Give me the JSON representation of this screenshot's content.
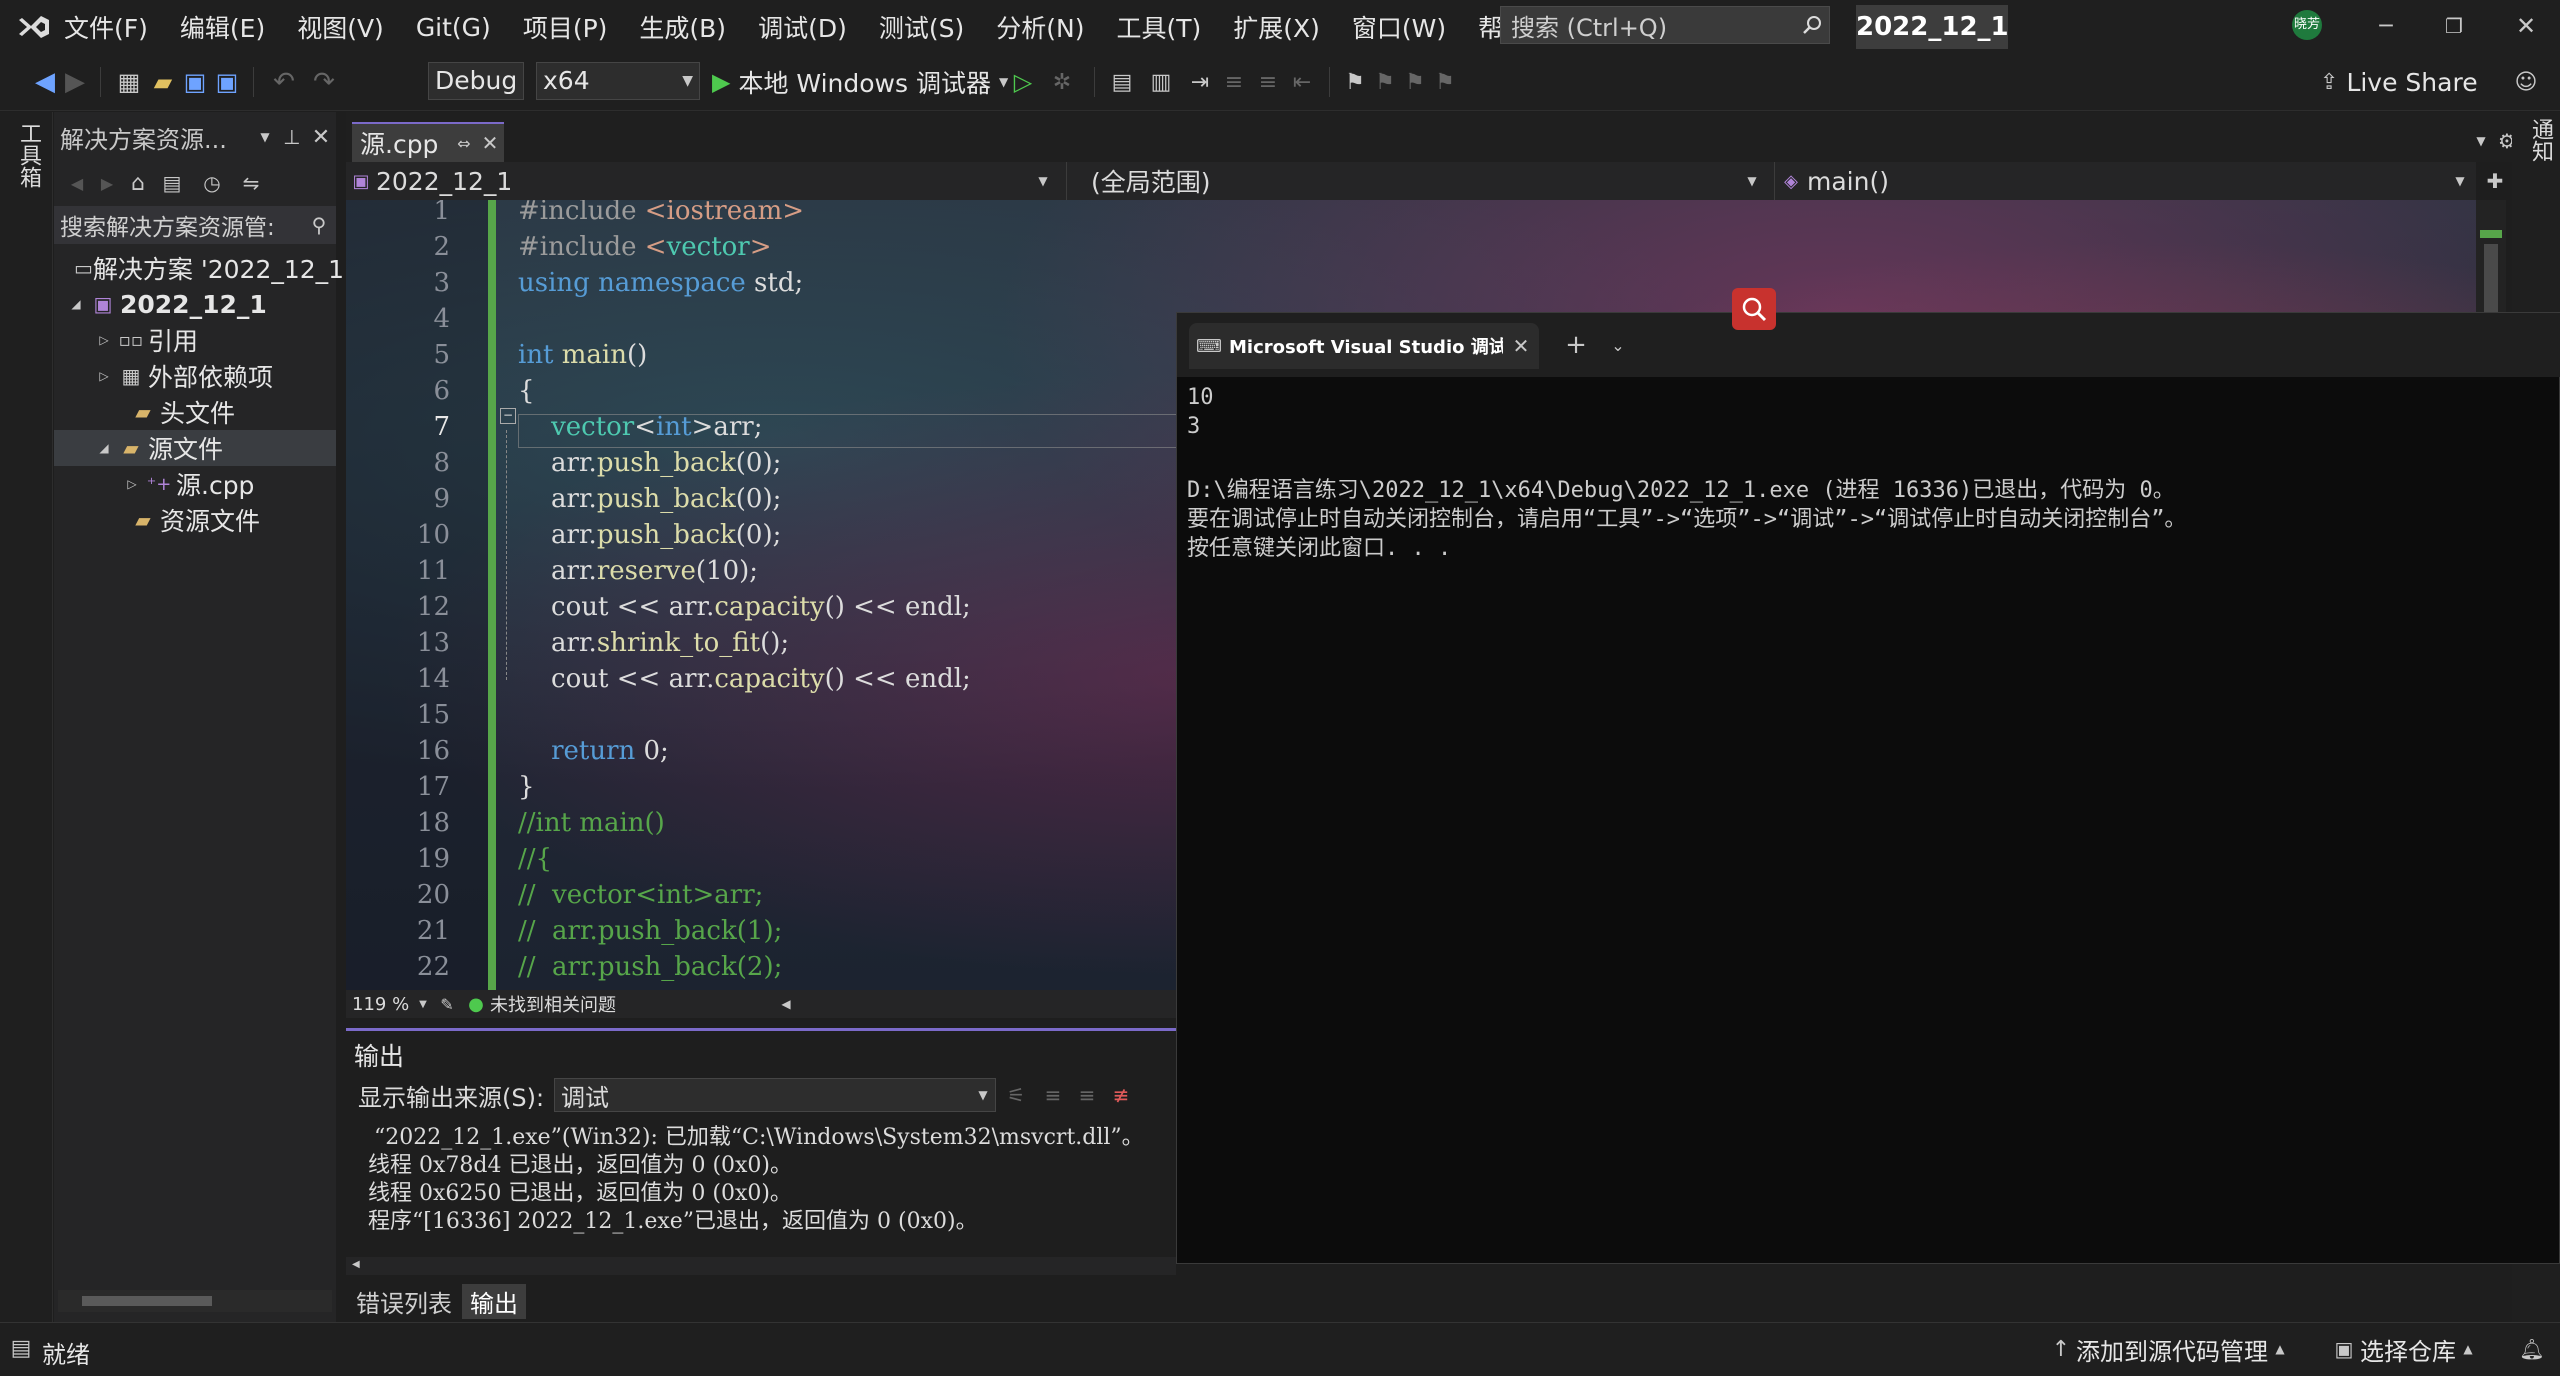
{
  "menu": {
    "items": [
      "文件(F)",
      "编辑(E)",
      "视图(V)",
      "Git(G)",
      "项目(P)",
      "生成(B)",
      "调试(D)",
      "测试(S)",
      "分析(N)",
      "工具(T)",
      "扩展(X)",
      "窗口(W)",
      "帮助(H)"
    ],
    "search_placeholder": "搜索 (Ctrl+Q)",
    "solution_name": "2022_12_1",
    "user_badge": "晓芳"
  },
  "toolbar": {
    "config_value": "Debug",
    "platform_value": "x64",
    "run_label": "本地 Windows 调试器",
    "live_share": "Live Share"
  },
  "left_strip": {
    "label": "工具箱"
  },
  "right_strip": {
    "label": "通知"
  },
  "solution_explorer": {
    "title": "解决方案资源...",
    "search_placeholder": "搜索解决方案资源管:",
    "items": [
      {
        "label": "解决方案 '2022_12_1"
      },
      {
        "label": "2022_12_1"
      },
      {
        "label": "引用"
      },
      {
        "label": "外部依赖项"
      },
      {
        "label": "头文件"
      },
      {
        "label": "源文件"
      },
      {
        "label": "源.cpp"
      },
      {
        "label": "资源文件"
      }
    ]
  },
  "editor": {
    "tab_label": "源.cpp",
    "nav_project": "2022_12_1",
    "nav_scope": "(全局范围)",
    "nav_member": "main()",
    "zoom": "119 %",
    "issues": "未找到相关问题",
    "current_line": 7,
    "lines": [
      {
        "n": "1",
        "text": "#include <iostream>"
      },
      {
        "n": "2",
        "text": "#include <vector>"
      },
      {
        "n": "3",
        "text": "using namespace std;"
      },
      {
        "n": "4",
        "text": ""
      },
      {
        "n": "5",
        "text": "int main()"
      },
      {
        "n": "6",
        "text": "{"
      },
      {
        "n": "7",
        "text": "    vector<int>arr;"
      },
      {
        "n": "8",
        "text": "    arr.push_back(0);"
      },
      {
        "n": "9",
        "text": "    arr.push_back(0);"
      },
      {
        "n": "10",
        "text": "    arr.push_back(0);"
      },
      {
        "n": "11",
        "text": "    arr.reserve(10);"
      },
      {
        "n": "12",
        "text": "    cout << arr.capacity() << endl;"
      },
      {
        "n": "13",
        "text": "    arr.shrink_to_fit();"
      },
      {
        "n": "14",
        "text": "    cout << arr.capacity() << endl;"
      },
      {
        "n": "15",
        "text": ""
      },
      {
        "n": "16",
        "text": "    return 0;"
      },
      {
        "n": "17",
        "text": "}"
      },
      {
        "n": "18",
        "text": "//int main()"
      },
      {
        "n": "19",
        "text": "//{"
      },
      {
        "n": "20",
        "text": "//  vector<int>arr;"
      },
      {
        "n": "21",
        "text": "//  arr.push_back(1);"
      },
      {
        "n": "22",
        "text": "//  arr.push_back(2);"
      }
    ]
  },
  "output": {
    "title": "输出",
    "source_label": "显示输出来源(S):",
    "source_value": "调试",
    "lines": [
      "“2022_12_1.exe”(Win32): 已加载“C:\\Windows\\System32\\msvcrt.dll”。",
      "线程 0x78d4 已退出，返回值为 0 (0x0)。",
      "线程 0x6250 已退出，返回值为 0 (0x0)。",
      "程序“[16336] 2022_12_1.exe”已退出，返回值为 0 (0x0)。"
    ],
    "tabs": [
      "错误列表",
      "输出"
    ]
  },
  "console": {
    "tab_title": "Microsoft Visual Studio 调试控",
    "lines": [
      "10",
      "3",
      "",
      "D:\\编程语言练习\\2022_12_1\\x64\\Debug\\2022_12_1.exe (进程 16336)已退出，代码为 0。",
      "要在调试停止时自动关闭控制台，请启用“工具”->“选项”->“调试”->“调试停止时自动关闭控制台”。",
      "按任意键关闭此窗口. . ."
    ]
  },
  "status": {
    "ready": "就绪",
    "source_control": "添加到源代码管理",
    "repo": "选择仓库"
  },
  "colors": {
    "accent": "#7b6ac9",
    "keyword": "#569cd6",
    "comment": "#57a64a",
    "green_bar": "#57a64a"
  }
}
